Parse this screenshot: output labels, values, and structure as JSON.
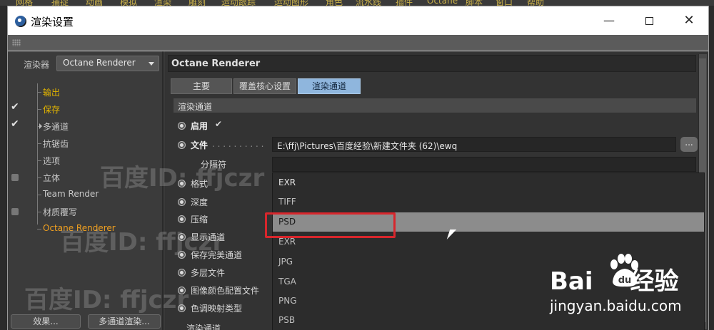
{
  "host_menu": [
    "网格",
    "捕捉",
    "动画",
    "模拟",
    "渲染",
    "雕刻",
    "运动跟踪",
    "运动图形",
    "角色",
    "流水线",
    "插件",
    "Octane",
    "脚本",
    "窗口",
    "帮助"
  ],
  "window": {
    "title": "渲染设置",
    "minimize": "—",
    "close": "✕"
  },
  "left_panel": {
    "renderer_label": "渲染器",
    "renderer_value": "Octane Renderer",
    "tree": [
      {
        "label": "输出",
        "style": "gold",
        "marker": ""
      },
      {
        "label": "保存",
        "style": "gold",
        "marker": "✔"
      },
      {
        "label": "多通道",
        "style": "normal",
        "marker": "✔"
      },
      {
        "label": "抗锯齿",
        "style": "normal",
        "marker": ""
      },
      {
        "label": "选项",
        "style": "normal",
        "marker": ""
      },
      {
        "label": "立体",
        "style": "normal",
        "marker": "box"
      },
      {
        "label": "Team Render",
        "style": "normal",
        "marker": ""
      },
      {
        "label": "材质覆写",
        "style": "normal",
        "marker": "box"
      },
      {
        "label": "Octane Renderer",
        "style": "orange",
        "marker": ""
      }
    ],
    "effects_button": "效果...",
    "multipass_button": "多通道渲染..."
  },
  "right_panel": {
    "header": "Octane Renderer",
    "tabs": [
      "主要",
      "覆盖核心设置",
      "渲染通道"
    ],
    "active_tab": "渲染通道",
    "section_title": "渲染通道",
    "params": {
      "enable": "启用",
      "enable_check": "✔",
      "file": "文件",
      "file_path": "E:\\ffj\\Pictures\\百度经验\\新建文件夹 (62)\\ewq",
      "file_button": "...",
      "separator": "分隔符",
      "format": "格式",
      "depth": "深度",
      "compress": "压缩",
      "show_passes": "显示通道",
      "save_beauty": "保存完美通道",
      "multilayer": "多层文件",
      "color_profile": "图像颜色配置文件",
      "tonemap": "色调映射类型",
      "bottom_section": "渲染通道"
    },
    "dropdown_options": [
      "EXR",
      "TIFF",
      "PSD",
      "EXR",
      "JPG",
      "TGA",
      "PNG",
      "PSB"
    ],
    "dropdown_highlighted": "PSD"
  },
  "watermarks": {
    "wm1": "百度ID: ffjczr",
    "wm2": "百度ID: ffjczr",
    "wm3": "百度ID: ffjczr",
    "baidu_logo": "Bai",
    "baidu_logo_suffix": "经验",
    "baidu_url": "jingyan.baidu.com"
  },
  "colors": {
    "active_tab": "#8fb6dd",
    "highlight_row": "#8c8c8c",
    "red_annotation": "#d8262c",
    "gold_item": "#e2b400",
    "orange_item": "#f0a020"
  }
}
